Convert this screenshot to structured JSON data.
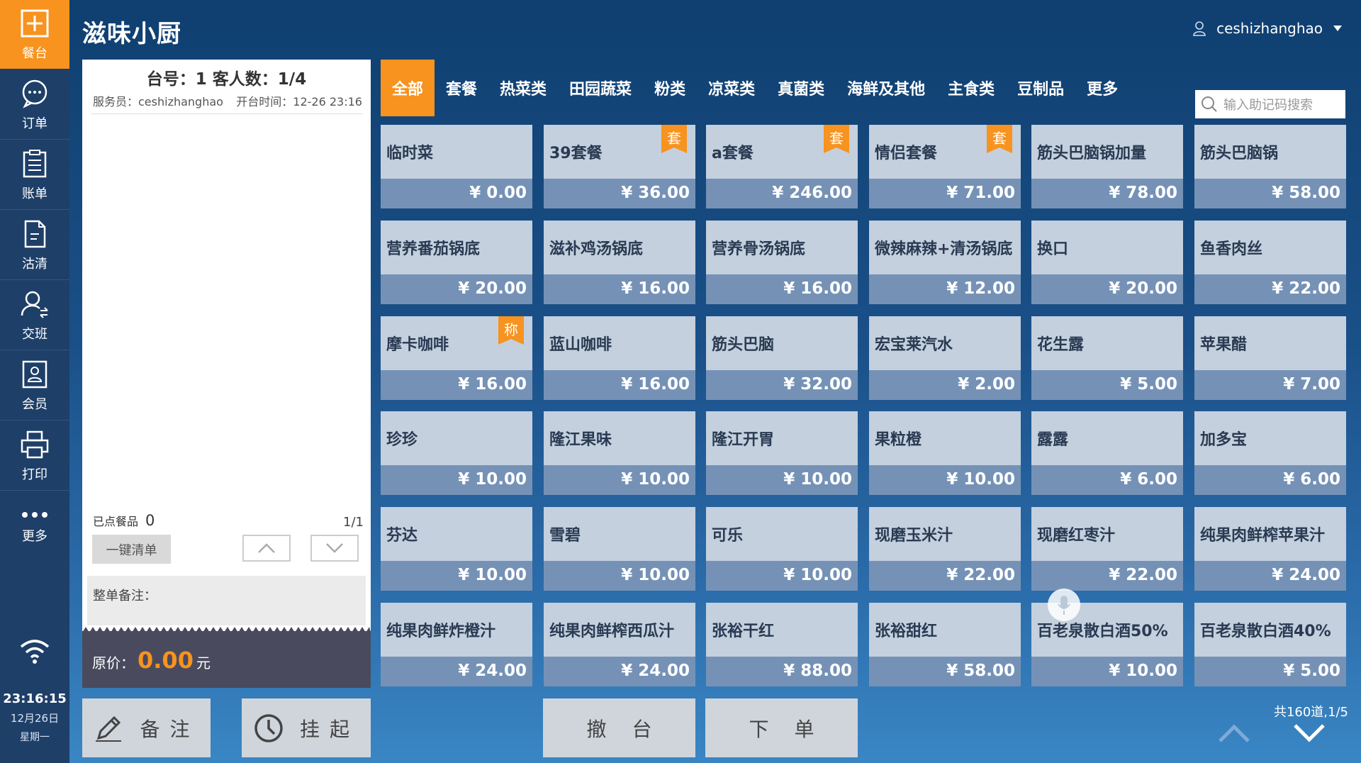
{
  "app": {
    "title": "滋味小厨"
  },
  "user": {
    "name": "ceshizhanghao"
  },
  "sidebar": {
    "items": [
      {
        "label": "餐台",
        "icon": "plus-box-icon"
      },
      {
        "label": "订单",
        "icon": "chat-icon"
      },
      {
        "label": "账单",
        "icon": "clipboard-icon"
      },
      {
        "label": "沽清",
        "icon": "document-icon"
      },
      {
        "label": "交班",
        "icon": "user-swap-icon"
      },
      {
        "label": "会员",
        "icon": "member-card-icon"
      },
      {
        "label": "打印",
        "icon": "printer-icon"
      },
      {
        "label": "更多",
        "icon": "more-dots-icon"
      }
    ],
    "time": "23:16:15",
    "date": "12月26日",
    "weekday": "星期一"
  },
  "order": {
    "table_info": "台号：1  客人数：1/4",
    "waiter": "服务员：ceshizhanghao",
    "open_time": "开台时间：12-26 23:16",
    "ordered_label": "已点餐品",
    "ordered_count": "0",
    "page": "1/1",
    "clear_label": "一键清单",
    "remark_label": "整单备注：",
    "total_label": "原价：",
    "total_value": "0.00",
    "total_unit": "元"
  },
  "actions": {
    "remark": "备注",
    "hang": "挂起",
    "cancel": "撤台",
    "submit": "下单"
  },
  "tabs": [
    "全部",
    "套餐",
    "热菜类",
    "田园蔬菜",
    "粉类",
    "凉菜类",
    "真菌类",
    "海鲜及其他",
    "主食类",
    "豆制品",
    "更多"
  ],
  "search": {
    "placeholder": "输入助记码搜索"
  },
  "menu_items": [
    {
      "name": "临时菜",
      "price": "¥ 0.00",
      "tag": ""
    },
    {
      "name": "39套餐",
      "price": "¥ 36.00",
      "tag": "套"
    },
    {
      "name": "a套餐",
      "price": "¥ 246.00",
      "tag": "套"
    },
    {
      "name": "情侣套餐",
      "price": "¥ 71.00",
      "tag": "套"
    },
    {
      "name": "筋头巴脑锅加量",
      "price": "¥ 78.00",
      "tag": ""
    },
    {
      "name": "筋头巴脑锅",
      "price": "¥ 58.00",
      "tag": ""
    },
    {
      "name": "营养番茄锅底",
      "price": "¥ 20.00",
      "tag": ""
    },
    {
      "name": "滋补鸡汤锅底",
      "price": "¥ 16.00",
      "tag": ""
    },
    {
      "name": "营养骨汤锅底",
      "price": "¥ 16.00",
      "tag": ""
    },
    {
      "name": "微辣麻辣+清汤锅底",
      "price": "¥ 12.00",
      "tag": ""
    },
    {
      "name": "换口",
      "price": "¥ 20.00",
      "tag": ""
    },
    {
      "name": "鱼香肉丝",
      "price": "¥ 22.00",
      "tag": ""
    },
    {
      "name": "摩卡咖啡",
      "price": "¥ 16.00",
      "tag": "称"
    },
    {
      "name": "蓝山咖啡",
      "price": "¥ 16.00",
      "tag": ""
    },
    {
      "name": "筋头巴脑",
      "price": "¥ 32.00",
      "tag": ""
    },
    {
      "name": "宏宝莱汽水",
      "price": "¥ 2.00",
      "tag": ""
    },
    {
      "name": "花生露",
      "price": "¥ 5.00",
      "tag": ""
    },
    {
      "name": "苹果醋",
      "price": "¥ 7.00",
      "tag": ""
    },
    {
      "name": "珍珍",
      "price": "¥ 10.00",
      "tag": ""
    },
    {
      "name": "隆江果味",
      "price": "¥ 10.00",
      "tag": ""
    },
    {
      "name": "隆江开胃",
      "price": "¥ 10.00",
      "tag": ""
    },
    {
      "name": "果粒橙",
      "price": "¥ 10.00",
      "tag": ""
    },
    {
      "name": "露露",
      "price": "¥ 6.00",
      "tag": ""
    },
    {
      "name": "加多宝",
      "price": "¥ 6.00",
      "tag": ""
    },
    {
      "name": "芬达",
      "price": "¥ 10.00",
      "tag": ""
    },
    {
      "name": "雪碧",
      "price": "¥ 10.00",
      "tag": ""
    },
    {
      "name": "可乐",
      "price": "¥ 10.00",
      "tag": ""
    },
    {
      "name": "现磨玉米汁",
      "price": "¥ 22.00",
      "tag": ""
    },
    {
      "name": "现磨红枣汁",
      "price": "¥ 22.00",
      "tag": ""
    },
    {
      "name": "纯果肉鲜榨苹果汁",
      "price": "¥ 24.00",
      "tag": ""
    },
    {
      "name": "纯果肉鲜炸橙汁",
      "price": "¥ 24.00",
      "tag": ""
    },
    {
      "name": "纯果肉鲜榨西瓜汁",
      "price": "¥ 24.00",
      "tag": ""
    },
    {
      "name": "张裕干红",
      "price": "¥ 88.00",
      "tag": ""
    },
    {
      "name": "张裕甜红",
      "price": "¥ 58.00",
      "tag": ""
    },
    {
      "name": "百老泉散白酒50%",
      "price": "¥ 10.00",
      "tag": ""
    },
    {
      "name": "百老泉散白酒40%",
      "price": "¥ 5.00",
      "tag": ""
    }
  ],
  "pagination": {
    "info": "共160道,1/5"
  },
  "colors": {
    "accent": "#f7931e",
    "sidebar": "#1e3f68",
    "card_top": "#c4d0de",
    "card_bottom": "#7592b6"
  }
}
